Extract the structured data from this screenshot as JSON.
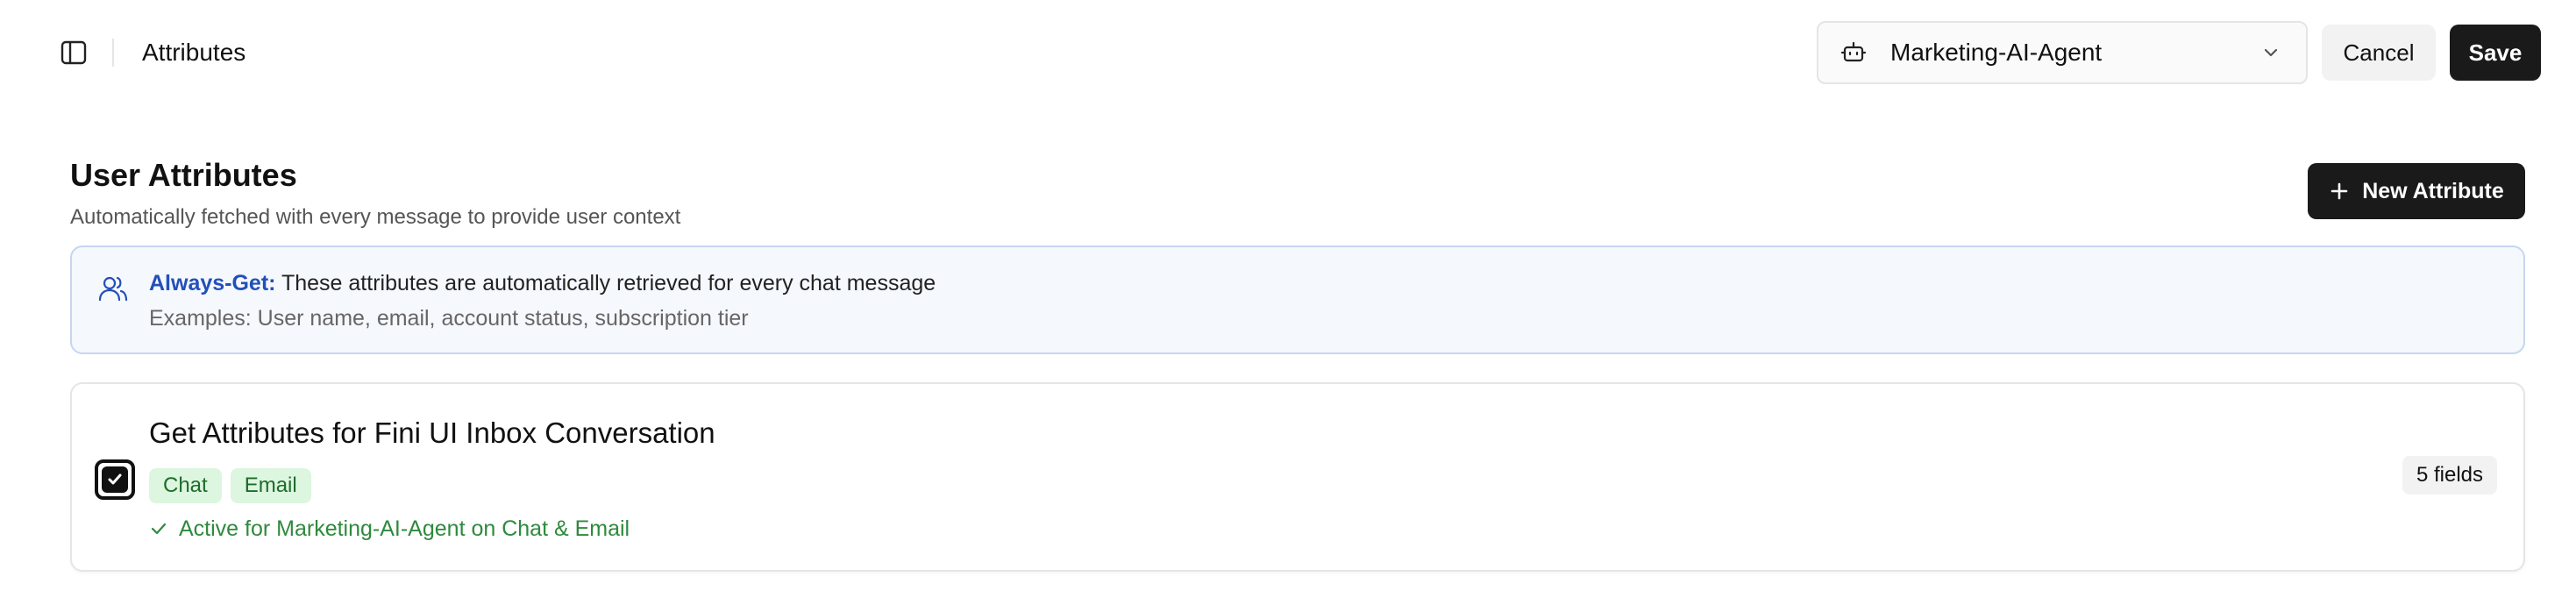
{
  "header": {
    "title": "Attributes",
    "agent_select": {
      "value": "Marketing-AI-Agent",
      "icon": "bot-icon"
    },
    "cancel_label": "Cancel",
    "save_label": "Save"
  },
  "section": {
    "title": "User Attributes",
    "subtitle": "Automatically fetched with every message to provide user context",
    "new_button_label": "New Attribute"
  },
  "info": {
    "strong": "Always-Get:",
    "text": " These attributes are automatically retrieved for every chat message",
    "examples": "Examples: User name, email, account status, subscription tier",
    "icon": "users-icon"
  },
  "attribute_card": {
    "title": "Get Attributes for Fini UI Inbox Conversation",
    "checked": true,
    "tags": [
      "Chat",
      "Email"
    ],
    "status": "Active for Marketing-AI-Agent on Chat & Email",
    "fields_badge": "5 fields"
  },
  "colors": {
    "primary": "#1a1a1a",
    "info_accent": "#2250b9",
    "info_bg": "#f5f8fd",
    "tag_bg": "#dcf6df",
    "success": "#2e8a3d"
  }
}
